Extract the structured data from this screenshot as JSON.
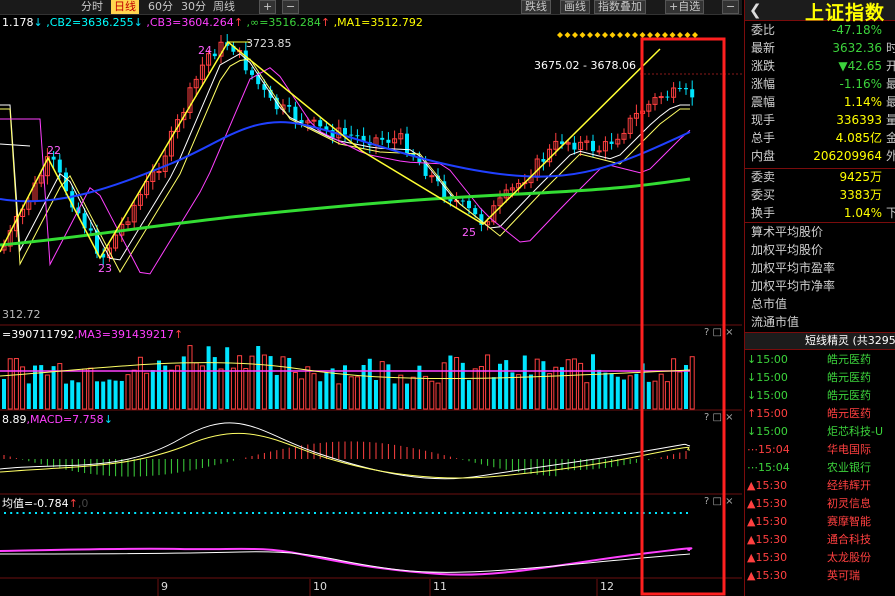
{
  "toolbar": {
    "items": [
      "分时",
      "日线",
      "60分",
      "30分",
      "周线",
      "+",
      "−",
      "跌线",
      "画线",
      "指数叠加",
      "+自选",
      "−"
    ],
    "active": "日线"
  },
  "main_chart": {
    "indicators": [
      {
        "text": "1.178",
        "color": "#ffffff"
      },
      {
        "text": ",CB2=3636.255",
        "color": "#00ffff"
      },
      {
        "text": ",CB3=3604.264",
        "color": "#ff40ff"
      },
      {
        "text": ",∞=3516.284",
        "color": "#3cd33c"
      },
      {
        "text": ",MA1=3512.792",
        "color": "#ffff00"
      }
    ],
    "annotations": {
      "peak": "3723.85",
      "range": "3675.02 - 3678.06",
      "low": "312.72"
    },
    "wave_labels": [
      "22",
      "23",
      "24",
      "25"
    ],
    "dates": [
      "9",
      "10",
      "11",
      "12"
    ]
  },
  "volume_panel": {
    "indicators": [
      {
        "text": "=390711792",
        "color": "#ffffff"
      },
      {
        "text": ",MA3=391439217",
        "color": "#ff40ff"
      }
    ]
  },
  "macd_panel": {
    "indicators": [
      {
        "text": "8.89",
        "color": "#ffffff"
      },
      {
        "text": ",MACD=7.758",
        "color": "#ff40ff"
      }
    ]
  },
  "avg_panel": {
    "indicators": [
      {
        "text": "均值=-0.784",
        "color": "#ffffff"
      },
      {
        "text": ",0",
        "color": "#444444"
      }
    ]
  },
  "panel_controls": "? □ ×",
  "quote": {
    "title": "上证指数",
    "back_icon": "left-arrow-icon",
    "rows": [
      {
        "label": "委比",
        "value": "-47.18%",
        "color": "#3cd33c",
        "ext": ""
      },
      {
        "label": "最新",
        "value": "3632.36",
        "color": "#3cd33c",
        "ext": "时"
      },
      {
        "label": "涨跌",
        "value": "▼42.65",
        "color": "#3cd33c",
        "ext": "开"
      },
      {
        "label": "涨幅",
        "value": "-1.16%",
        "color": "#3cd33c",
        "ext": "最"
      },
      {
        "label": "震幅",
        "value": "1.14%",
        "color": "#ffff00",
        "ext": "最"
      },
      {
        "label": "现手",
        "value": "336393",
        "color": "#ffff00",
        "ext": "量"
      },
      {
        "label": "总手",
        "value": "4.085亿",
        "color": "#ffff00",
        "ext": "金"
      },
      {
        "label": "内盘",
        "value": "206209964",
        "color": "#ffff00",
        "ext": "外"
      },
      {
        "label": "委卖",
        "value": "9425万",
        "color": "#ffff00",
        "ext": ""
      },
      {
        "label": "委买",
        "value": "3383万",
        "color": "#ffff00",
        "ext": ""
      },
      {
        "label": "换手",
        "value": "1.04%",
        "color": "#ffff00",
        "ext": "下"
      }
    ],
    "stats": [
      "算术平均股价",
      "加权平均股价",
      "加权平均市盈率",
      "加权平均市净率",
      "总市值",
      "流通市值"
    ]
  },
  "jingling": {
    "header": "短线精灵 (共3295",
    "rows": [
      {
        "arrow": "↓",
        "time": "15:00",
        "name": "皓元医药",
        "tcolor": "#3cd33c",
        "ncolor": "#3cd33c"
      },
      {
        "arrow": "↓",
        "time": "15:00",
        "name": "皓元医药",
        "tcolor": "#3cd33c",
        "ncolor": "#3cd33c"
      },
      {
        "arrow": "↓",
        "time": "15:00",
        "name": "皓元医药",
        "tcolor": "#3cd33c",
        "ncolor": "#3cd33c"
      },
      {
        "arrow": "↑",
        "time": "15:00",
        "name": "皓元医药",
        "tcolor": "#ff4040",
        "ncolor": "#ff4040"
      },
      {
        "arrow": "↓",
        "time": "15:00",
        "name": "炬芯科技-U",
        "tcolor": "#3cd33c",
        "ncolor": "#3cd33c"
      },
      {
        "arrow": "⋯",
        "time": "15:04",
        "name": "华电国际",
        "tcolor": "#ff4040",
        "ncolor": "#ff4040"
      },
      {
        "arrow": "⋯",
        "time": "15:04",
        "name": "农业银行",
        "tcolor": "#3cd33c",
        "ncolor": "#3cd33c"
      },
      {
        "arrow": "▲",
        "time": "15:30",
        "name": "经纬辉开",
        "tcolor": "#ff4040",
        "ncolor": "#ff4040"
      },
      {
        "arrow": "▲",
        "time": "15:30",
        "name": "初灵信息",
        "tcolor": "#ff4040",
        "ncolor": "#ff4040"
      },
      {
        "arrow": "▲",
        "time": "15:30",
        "name": "赛摩智能",
        "tcolor": "#ff4040",
        "ncolor": "#ff4040"
      },
      {
        "arrow": "▲",
        "time": "15:30",
        "name": "通合科技",
        "tcolor": "#ff4040",
        "ncolor": "#ff4040"
      },
      {
        "arrow": "▲",
        "time": "15:30",
        "name": "太龙股份",
        "tcolor": "#ff4040",
        "ncolor": "#ff4040"
      },
      {
        "arrow": "▲",
        "time": "15:30",
        "name": "英可瑞",
        "tcolor": "#ff4040",
        "ncolor": "#ff4040"
      }
    ]
  },
  "colors": {
    "up": "#ff4040",
    "down": "#00e5ff",
    "ma_yellow": "#ffff00",
    "ma_blue": "#2040ff",
    "ma_green": "#33dd33",
    "highlight_box": "#ff2020"
  }
}
